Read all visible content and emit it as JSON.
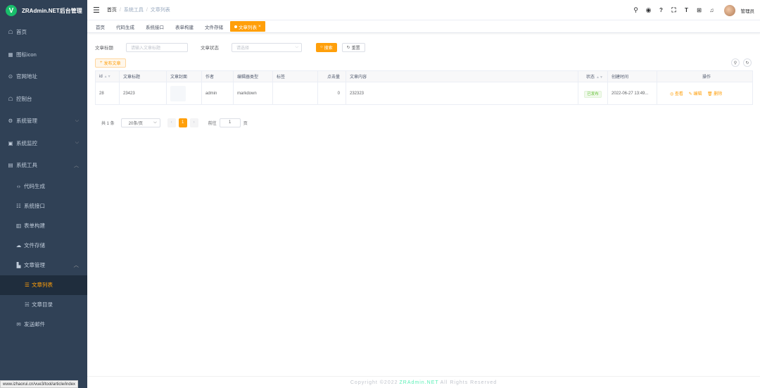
{
  "app": {
    "logo_letter": "V",
    "title": "ZRAdmin.NET后台管理"
  },
  "sidebar": {
    "items": [
      {
        "icon": "dashboard-icon",
        "glyph": "☖",
        "label": "首页"
      },
      {
        "icon": "grid-icon",
        "glyph": "▦",
        "label": "图标icon"
      },
      {
        "icon": "link-icon",
        "glyph": "⊙",
        "label": "官网地址"
      },
      {
        "icon": "dashboard-icon",
        "glyph": "☖",
        "label": "控制台"
      },
      {
        "icon": "gear-icon",
        "glyph": "⚙",
        "label": "系统管理"
      },
      {
        "icon": "monitor-icon",
        "glyph": "▣",
        "label": "系统监控"
      },
      {
        "icon": "toolbox-icon",
        "glyph": "▤",
        "label": "系统工具"
      }
    ],
    "tool_children": [
      {
        "icon": "code-icon",
        "glyph": "‹›",
        "label": "代码生成"
      },
      {
        "icon": "api-icon",
        "glyph": "☷",
        "label": "系统接口"
      },
      {
        "icon": "form-icon",
        "glyph": "▥",
        "label": "表单构建"
      },
      {
        "icon": "cloud-icon",
        "glyph": "☁",
        "label": "文件存储"
      },
      {
        "icon": "article-icon",
        "glyph": "▙",
        "label": "文章管理"
      }
    ],
    "article_children": [
      {
        "icon": "list-icon",
        "glyph": "☰",
        "label": "文章列表"
      },
      {
        "icon": "tree-icon",
        "glyph": "☵",
        "label": "文章目录"
      }
    ],
    "send_mail": {
      "icon": "mail-icon",
      "glyph": "✉",
      "label": "发送邮件"
    }
  },
  "breadcrumb": [
    "首页",
    "系统工具",
    "文章列表"
  ],
  "tags": [
    "首页",
    "代码生成",
    "系统接口",
    "表单构建",
    "文件存储",
    "文章列表"
  ],
  "header": {
    "icons": [
      "search-icon",
      "github-icon",
      "question-icon",
      "fullscreen-icon",
      "font-size-icon",
      "translate-icon",
      "bell-icon"
    ],
    "username": "管理员"
  },
  "search": {
    "title_label": "文章标题",
    "title_placeholder": "请输入文章标题",
    "status_label": "文章状态",
    "status_placeholder": "请选择",
    "search_button": "搜索",
    "reset_button": "重置"
  },
  "toolbar": {
    "add_button": "发布文章"
  },
  "table": {
    "columns": [
      "id",
      "文章标题",
      "文章封面",
      "作者",
      "编辑器类型",
      "标签",
      "点击量",
      "文章内容",
      "状态",
      "创建时间",
      "操作"
    ],
    "rows": [
      {
        "id": "28",
        "title": "23423",
        "author": "admin",
        "editor": "markdown",
        "tags": "",
        "hits": "0",
        "content": "232323",
        "status": "已发布",
        "created": "2022-06-27 13:49...",
        "actions": [
          "查看",
          "编辑",
          "删除"
        ]
      }
    ]
  },
  "pagination": {
    "total": "共 1 条",
    "page_size": "20条/页",
    "current_page": "1",
    "goto_label": "前往",
    "goto_value": "1",
    "page_suffix": "页"
  },
  "footer": {
    "prefix": "Copyright ©2022",
    "brand": "ZRAdmin.NET",
    "suffix": "All Rights Reserved"
  },
  "status_url": "www.izhaorui.cn/vue3/tool/article/index",
  "colors": {
    "primary": "#ff9f0a",
    "sidebar_bg": "#304156",
    "success": "#67c23a"
  }
}
